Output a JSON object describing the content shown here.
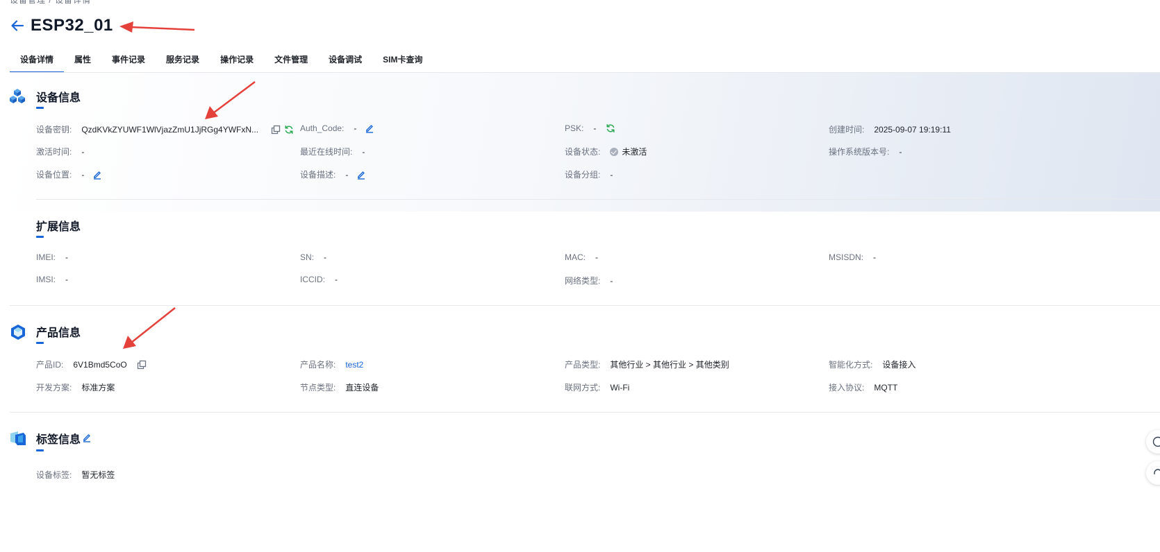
{
  "header": {
    "breadcrumb": "设备管理 / 设备详情",
    "title": "ESP32_01"
  },
  "tabs": [
    {
      "label": "设备详情",
      "active": true
    },
    {
      "label": "属性"
    },
    {
      "label": "事件记录"
    },
    {
      "label": "服务记录"
    },
    {
      "label": "操作记录"
    },
    {
      "label": "文件管理"
    },
    {
      "label": "设备调试"
    },
    {
      "label": "SIM卡查询"
    }
  ],
  "device_info": {
    "title": "设备信息",
    "secret": {
      "label": "设备密钥:",
      "value": "QzdKVkZYUWF1WlVjazZmU1JjRGg4YWFxN..."
    },
    "auth_code": {
      "label": "Auth_Code:",
      "value": "-"
    },
    "psk": {
      "label": "PSK:",
      "value": "-"
    },
    "created": {
      "label": "创建时间:",
      "value": "2025-09-07 19:19:11"
    },
    "activated": {
      "label": "激活时间:",
      "value": "-"
    },
    "last_online": {
      "label": "最近在线时间:",
      "value": "-"
    },
    "status": {
      "label": "设备状态:",
      "value": "未激活"
    },
    "os_version": {
      "label": "操作系统版本号:",
      "value": "-"
    },
    "location": {
      "label": "设备位置:",
      "value": "-"
    },
    "description": {
      "label": "设备描述:",
      "value": "-"
    },
    "group": {
      "label": "设备分组:",
      "value": "-"
    }
  },
  "ext_info": {
    "title": "扩展信息",
    "imei": {
      "label": "IMEI:",
      "value": "-"
    },
    "sn": {
      "label": "SN:",
      "value": "-"
    },
    "mac": {
      "label": "MAC:",
      "value": "-"
    },
    "msisdn": {
      "label": "MSISDN:",
      "value": "-"
    },
    "imsi": {
      "label": "IMSI:",
      "value": "-"
    },
    "iccid": {
      "label": "ICCID:",
      "value": "-"
    },
    "network": {
      "label": "网络类型:",
      "value": "-"
    }
  },
  "product_info": {
    "title": "产品信息",
    "id": {
      "label": "产品ID:",
      "value": "6V1Bmd5CoO"
    },
    "name": {
      "label": "产品名称:",
      "value": "test2"
    },
    "type": {
      "label": "产品类型:",
      "value": "其他行业 > 其他行业 > 其他类别"
    },
    "smart_mode": {
      "label": "智能化方式:",
      "value": "设备接入"
    },
    "dev_plan": {
      "label": "开发方案:",
      "value": "标准方案"
    },
    "node_type": {
      "label": "节点类型:",
      "value": "直连设备"
    },
    "net_mode": {
      "label": "联网方式:",
      "value": "Wi-Fi"
    },
    "protocol": {
      "label": "接入协议:",
      "value": "MQTT"
    }
  },
  "tag_info": {
    "title": "标签信息",
    "tags": {
      "label": "设备标签:",
      "value": "暂无标签"
    }
  },
  "colors": {
    "accent": "#1765d6",
    "refresh": "#2eaa55",
    "annotation": "#e5413b"
  },
  "icons": [
    "back-arrow-icon",
    "cube-icon",
    "copy-icon",
    "refresh-icon",
    "edit-icon",
    "check-circle-icon",
    "hexagon-icon",
    "tag-icon"
  ]
}
